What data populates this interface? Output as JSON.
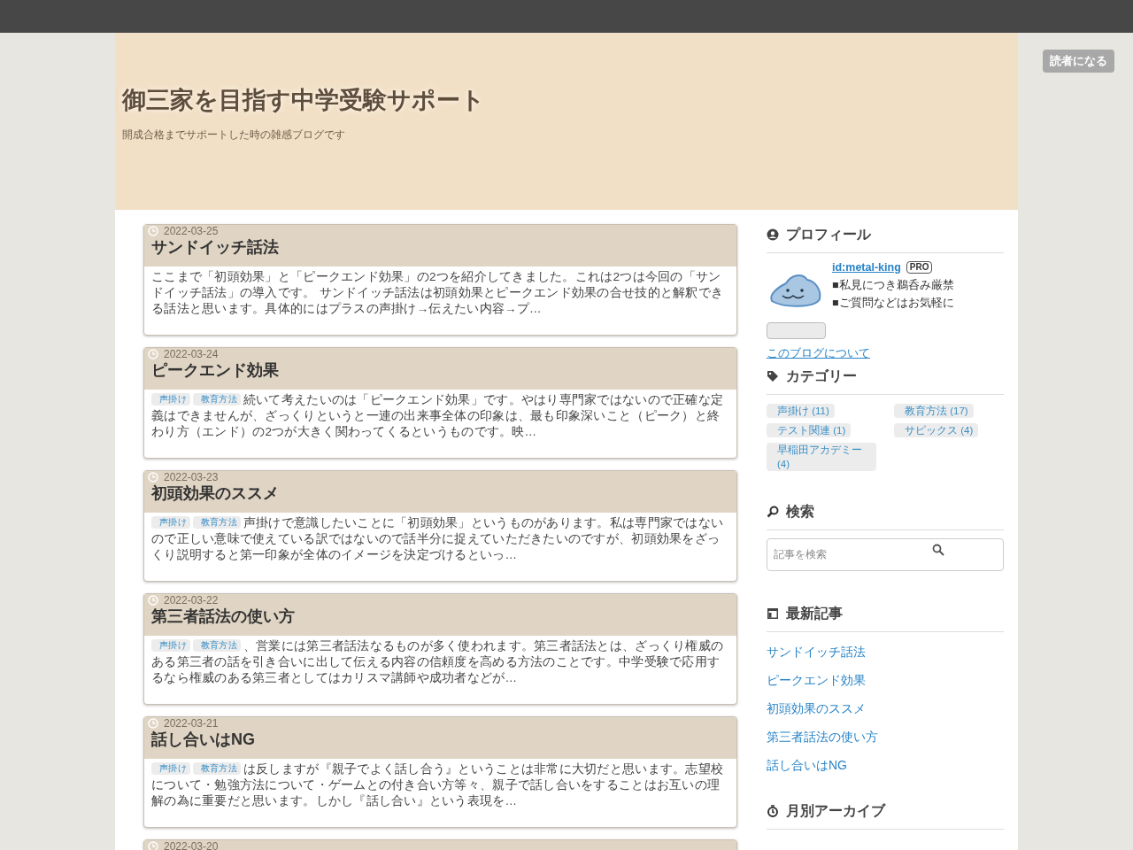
{
  "header": {
    "title": "御三家を目指す中学受験サポート",
    "subtitle": "開成合格までサポートした時の雑感ブログです",
    "subscribe_button": "読者になる"
  },
  "posts": [
    {
      "date": "2022-03-25",
      "title": "サンドイッチ話法",
      "excerpt": "ここまで「初頭効果」と「ピークエンド効果」の2つを紹介してきました。これは2つは今回の「サンドイッチ話法」の導入です。 サンドイッチ話法は初頭効果とピークエンド効果の合せ技的と解釈できる話法と思います。具体的にはプラスの声掛け→伝えたい内容→プ…"
    },
    {
      "date": "2022-03-24",
      "title": "ピークエンド効果",
      "tags": [
        "声掛け",
        "教育方法"
      ],
      "excerpt": "続いて考えたいのは「ピークエンド効果」です。やはり専門家ではないので正確な定義はできませんが、ざっくりというと一連の出来事全体の印象は、最も印象深いこと（ピーク）と終わり方（エンド）の2つが大きく関わってくるというものです。映…"
    },
    {
      "date": "2022-03-23",
      "title": "初頭効果のススメ",
      "tags": [
        "声掛け",
        "教育方法"
      ],
      "excerpt": "声掛けで意識したいことに「初頭効果」というものがあります。私は専門家ではないので正しい意味で使えている訳ではないので話半分に捉えていただきたいのですが、初頭効果をざっくり説明すると第一印象が全体のイメージを決定づけるといっ…"
    },
    {
      "date": "2022-03-22",
      "title": "第三者話法の使い方",
      "tags": [
        "声掛け",
        "教育方法"
      ],
      "excerpt": "、営業には第三者話法なるものが多く使われます。第三者話法とは、ざっくり権威のある第三者の話を引き合いに出して伝える内容の信頼度を高める方法のことです。中学受験で応用するなら権威のある第三者としてはカリスマ講師や成功者などが…"
    },
    {
      "date": "2022-03-21",
      "title": "話し合いはNG",
      "tags": [
        "声掛け",
        "教育方法"
      ],
      "excerpt": "は反しますが『親子でよく話し合う』ということは非常に大切だと思います。志望校について・勉強方法について・ゲームとの付き合い方等々、親子で話し合いをすることはお互いの理解の為に重要だと思います。しかし『話し合い』という表現を…"
    },
    {
      "date": "2022-03-20"
    }
  ],
  "sidebar": {
    "profile": {
      "heading": "プロフィール",
      "user": "id:metal-king",
      "badge": "PRO",
      "lines": [
        "■私見につき鵜呑み厳禁",
        "■ご質問などはお気軽に"
      ],
      "about_link": "このブログについて"
    },
    "categories": {
      "heading": "カテゴリー",
      "items": [
        "声掛け (11)",
        "教育方法 (17)",
        "テスト関連 (1)",
        "サピックス (4)",
        "早稲田アカデミー (4)"
      ]
    },
    "search": {
      "heading": "検索",
      "placeholder": "記事を検索"
    },
    "recent": {
      "heading": "最新記事",
      "items": [
        "サンドイッチ話法",
        "ピークエンド効果",
        "初頭効果のススメ",
        "第三者話法の使い方",
        "話し合いはNG"
      ]
    },
    "archive": {
      "heading": "月別アーカイブ"
    }
  }
}
